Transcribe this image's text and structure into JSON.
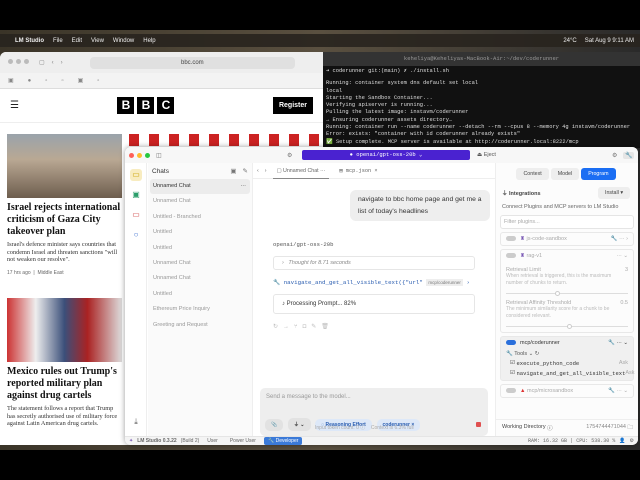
{
  "menubar": {
    "apple": "",
    "app": "LM Studio",
    "items": [
      "File",
      "Edit",
      "View",
      "Window",
      "Help"
    ],
    "weather": "24°C",
    "datetime": "Sat Aug 9  9:11 AM"
  },
  "safari": {
    "url": "bbc.com",
    "register": "Register",
    "logo": [
      "B",
      "B",
      "C"
    ],
    "articles": [
      {
        "title": "Israel rejects international criticism of Gaza City takeover plan",
        "summary": "Israel's defence minister says countries that condemn Israel and threaten sanctions \"will not weaken our resolve\".",
        "time": "17 hrs ago",
        "section": "Middle East"
      },
      {
        "title": "Mexico rules out Trump's reported military plan against drug cartels",
        "summary": "The statement follows a report that Trump has secretly authorised use of military force against Latin American drug cartels."
      }
    ]
  },
  "terminal": {
    "title": "keheliya@Keheliyas-MacBook-Air:~/dev/coderunner",
    "lines": [
      "➜  coderunner git:(main) ✗ ./install.sh",
      "Running: container system dns default set local",
      "local",
      "Starting the Sandbox Container...",
      "Verifying apiserver is running...",
      "Pulling the latest image: instavm/coderunner",
      "→ Ensuring coderunner assets directory…",
      "Running: container run --name coderunner --detach --rm --cpus 8 --memory 4g instavm/coderunner",
      "Error: exists: \"container with id coderunner already exists\"",
      "✅ Setup complete. MCP server is available at http://coderunner.local:8222/mcp"
    ]
  },
  "lmstudio": {
    "model": "openai/gpt-oss-20b",
    "eject": "Eject",
    "sidebar": {
      "title": "Chats",
      "items": [
        "Unnamed Chat",
        "Unnamed Chat",
        "Untitled - Branched",
        "Untitled",
        "Untitled",
        "Unnamed Chat",
        "Unnamed Chat",
        "Untitled",
        "Ethereum Price Inquiry",
        "Greeting and Request"
      ]
    },
    "tabs": [
      "Unnamed Chat",
      "mcp.json"
    ],
    "user_message": "navigate to bbc home page and get me a list of today's headlines",
    "assistant_model": "openai/gpt-oss-20b",
    "thought": "Thought for 8.71 seconds",
    "tool_call": "navigate_and_get_all_visible_text({\"url\"",
    "tool_badge": "mcp/coderunner",
    "processing": "Processing Prompt... 82%",
    "input_placeholder": "Send a message to the model...",
    "chips": {
      "reasoning": "Reasoning Effort",
      "plugin": "coderunner"
    },
    "footer": {
      "tokens": "Input token count:  0",
      "context": "Context is 6.3% full"
    },
    "panel": {
      "tabs": [
        "Context",
        "Model",
        "Program"
      ],
      "active_tab": "Program",
      "integrations": "Integrations",
      "install": "Install",
      "description": "Connect Plugins and MCP servers to LM Studio",
      "filter_placeholder": "Filter plugins...",
      "plugins": {
        "js": "js-code-sandbox",
        "rag": "rag-v1",
        "coderunner": "mcp/coderunner",
        "microsandbox": "mcp/microsandbox"
      },
      "retrieval_limit": {
        "label": "Retrieval Limit",
        "value": "3",
        "desc": "When retrieval is triggered, this is the maximum number of chunks to return."
      },
      "affinity": {
        "label": "Retrieval Affinity Threshold",
        "value": "0.5",
        "desc": "The minimum similarity score for a chunk to be considered relevant."
      },
      "tools_label": "Tools",
      "tools": [
        {
          "name": "execute_python_code",
          "perm": "Ask"
        },
        {
          "name": "navigate_and_get_all_visible_text",
          "perm": "Ask"
        }
      ],
      "working_dir": {
        "label": "Working Directory",
        "value": "1754744471044"
      }
    },
    "status": {
      "version": "LM Studio 0.3.22",
      "build": "(Build 2)",
      "modes": [
        "User",
        "Power User",
        "Developer"
      ],
      "active_mode": "Developer",
      "ram": "RAM: 16.32 GB",
      "cpu": "CPU: 538.30 %"
    },
    "colors": {
      "accent": "#4a22d0",
      "program_tab": "#1b6ef3",
      "toggle_on": "#2a6fdb"
    }
  }
}
